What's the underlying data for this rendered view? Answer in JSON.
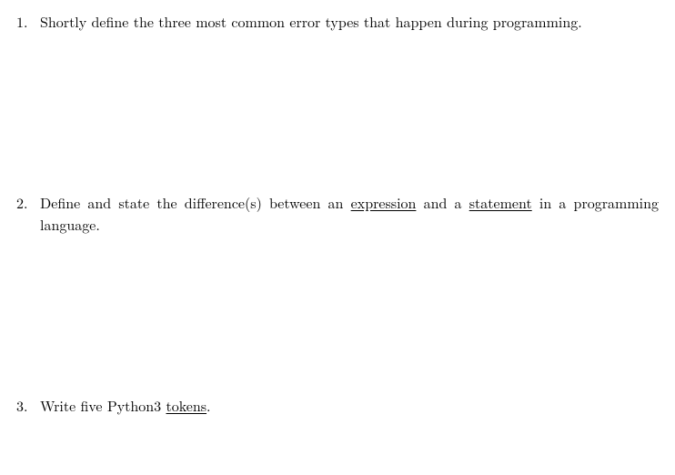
{
  "questions": [
    {
      "number": "1.",
      "text_before": "Shortly define the three most common error types that happen during programming."
    },
    {
      "number": "2.",
      "text_before": "Define and state the difference(s) between an ",
      "underline1": "expression",
      "text_mid": " and a ",
      "underline2": "statement",
      "text_after": " in a programming language."
    },
    {
      "number": "3.",
      "text_before": "Write five Python3 ",
      "underline1": "tokens",
      "text_after": "."
    }
  ]
}
